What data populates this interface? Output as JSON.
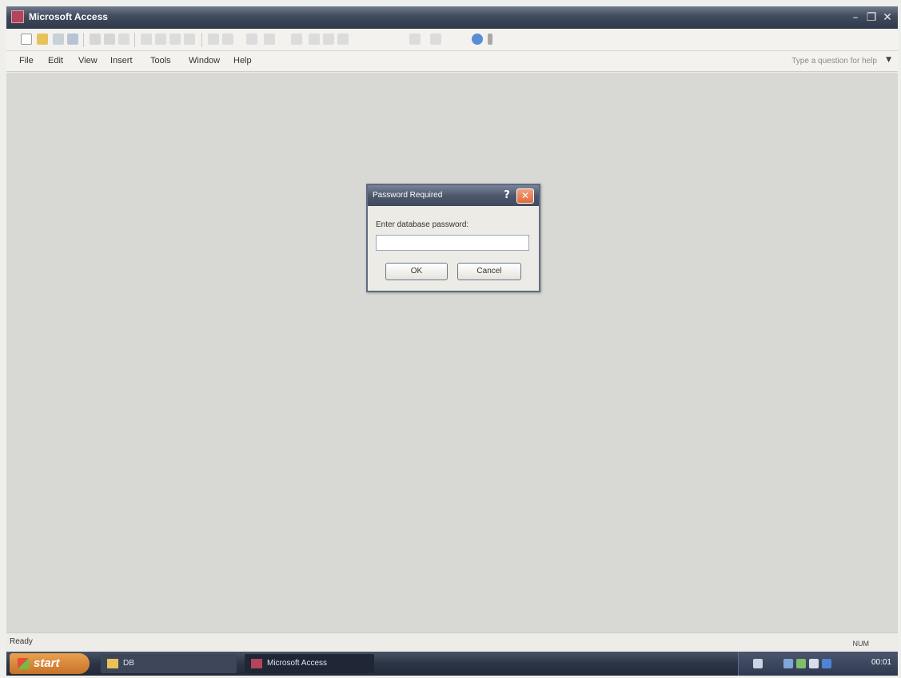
{
  "window": {
    "title": "Microsoft Access",
    "minimize": "–",
    "restore": "❐",
    "close": "✕"
  },
  "menu": {
    "items": [
      "File",
      "Edit",
      "View",
      "Insert",
      "Tools",
      "Window",
      "Help"
    ],
    "ask_placeholder": "Type a question for help"
  },
  "dialog": {
    "title": "Password Required",
    "help": "?",
    "close": "✕",
    "prompt": "Enter database password:",
    "input_value": "",
    "ok_label": "OK",
    "cancel_label": "Cancel"
  },
  "status": {
    "left": "Ready",
    "right": "NUM"
  },
  "taskbar": {
    "start_label": "start",
    "items": [
      "DB",
      "Microsoft Access"
    ],
    "clock": "00:01"
  },
  "colors": {
    "accent": "#3f4a5d",
    "close_button": "#e06a3a",
    "workspace": "#d8d8d4"
  }
}
